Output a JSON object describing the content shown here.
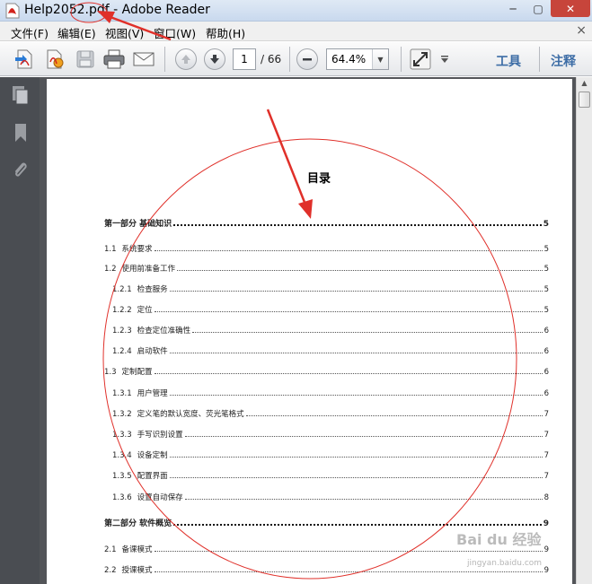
{
  "window": {
    "title": "Help2052.pdf - Adobe Reader",
    "minimize_glyph": "─",
    "maximize_glyph": "▢",
    "close_glyph": "✕"
  },
  "menu": {
    "items": [
      "文件(F)",
      "编辑(E)",
      "视图(V)",
      "窗口(W)",
      "帮助(H)"
    ],
    "close_glyph": "×"
  },
  "toolbar": {
    "page_current": "1",
    "page_total": "/ 66",
    "zoom": "64.4%",
    "tools_label": "工具",
    "comment_label": "注释",
    "icons": [
      "create-pdf-icon",
      "edit-pdf-icon",
      "save-icon",
      "print-icon",
      "email-icon",
      "page-up-icon",
      "page-down-icon",
      "zoom-out-icon",
      "fit-page-icon",
      "more-menu-icon"
    ]
  },
  "left_panel": {
    "icons": [
      "pages-thumbnail-icon",
      "bookmark-icon",
      "attachment-icon"
    ]
  },
  "document": {
    "toc_title": "目录",
    "entries": [
      {
        "num": "",
        "label": "第一部分  基础知识",
        "page": "5",
        "level": "part"
      },
      {
        "num": "1.1",
        "label": "系统要求",
        "page": "5",
        "level": "1"
      },
      {
        "num": "1.2",
        "label": "使用前准备工作",
        "page": "5",
        "level": "1"
      },
      {
        "num": "1.2.1",
        "label": "检查服务",
        "page": "5",
        "level": "2"
      },
      {
        "num": "1.2.2",
        "label": "定位",
        "page": "5",
        "level": "2"
      },
      {
        "num": "1.2.3",
        "label": "检查定位准确性",
        "page": "6",
        "level": "2"
      },
      {
        "num": "1.2.4",
        "label": "启动软件",
        "page": "6",
        "level": "2"
      },
      {
        "num": "1.3",
        "label": "定制配置",
        "page": "6",
        "level": "1"
      },
      {
        "num": "1.3.1",
        "label": "用户管理",
        "page": "6",
        "level": "2"
      },
      {
        "num": "1.3.2",
        "label": "定义笔的默认宽度、荧光笔格式",
        "page": "7",
        "level": "2"
      },
      {
        "num": "1.3.3",
        "label": "手写识别设置",
        "page": "7",
        "level": "2"
      },
      {
        "num": "1.3.4",
        "label": "设备定制",
        "page": "7",
        "level": "2"
      },
      {
        "num": "1.3.5",
        "label": "配置界面",
        "page": "7",
        "level": "2"
      },
      {
        "num": "1.3.6",
        "label": "设置自动保存",
        "page": "8",
        "level": "2"
      },
      {
        "num": "",
        "label": "第二部分  软件概览",
        "page": "9",
        "level": "part"
      },
      {
        "num": "2.1",
        "label": "备课模式",
        "page": "9",
        "level": "1"
      },
      {
        "num": "2.2",
        "label": "授课模式",
        "page": "9",
        "level": "1"
      }
    ]
  },
  "annotation": {
    "color": "#e0302a"
  },
  "watermark": {
    "text": "Bai du 经验",
    "sub": "jingyan.baidu.com"
  }
}
